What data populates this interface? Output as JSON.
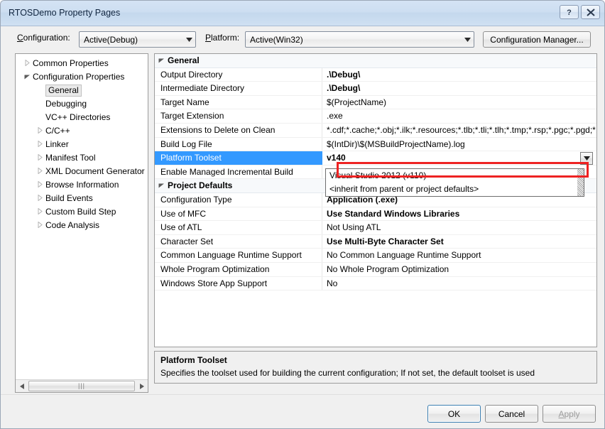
{
  "window": {
    "title": "RTOSDemo Property Pages",
    "help_button": "?",
    "close_button": "x"
  },
  "toolbar": {
    "configuration_label": "Configuration:",
    "configuration_value": "Active(Debug)",
    "platform_label": "Platform:",
    "platform_value": "Active(Win32)",
    "configuration_manager_label": "Configuration Manager..."
  },
  "tree": {
    "items": [
      {
        "label": "Common Properties",
        "indent": 0,
        "twisty": "collapsed",
        "selected": false
      },
      {
        "label": "Configuration Properties",
        "indent": 0,
        "twisty": "expanded",
        "selected": false
      },
      {
        "label": "General",
        "indent": 1,
        "twisty": "none",
        "selected": true
      },
      {
        "label": "Debugging",
        "indent": 1,
        "twisty": "none",
        "selected": false
      },
      {
        "label": "VC++ Directories",
        "indent": 1,
        "twisty": "none",
        "selected": false
      },
      {
        "label": "C/C++",
        "indent": 1,
        "twisty": "collapsed",
        "selected": false
      },
      {
        "label": "Linker",
        "indent": 1,
        "twisty": "collapsed",
        "selected": false
      },
      {
        "label": "Manifest Tool",
        "indent": 1,
        "twisty": "collapsed",
        "selected": false
      },
      {
        "label": "XML Document Generator",
        "indent": 1,
        "twisty": "collapsed",
        "selected": false
      },
      {
        "label": "Browse Information",
        "indent": 1,
        "twisty": "collapsed",
        "selected": false
      },
      {
        "label": "Build Events",
        "indent": 1,
        "twisty": "collapsed",
        "selected": false
      },
      {
        "label": "Custom Build Step",
        "indent": 1,
        "twisty": "collapsed",
        "selected": false
      },
      {
        "label": "Code Analysis",
        "indent": 1,
        "twisty": "collapsed",
        "selected": false
      }
    ]
  },
  "grid": {
    "rows": [
      {
        "kind": "group",
        "name": "General",
        "value": ""
      },
      {
        "kind": "prop",
        "name": "Output Directory",
        "value": ".\\Debug\\",
        "bold": true
      },
      {
        "kind": "prop",
        "name": "Intermediate Directory",
        "value": ".\\Debug\\",
        "bold": true
      },
      {
        "kind": "prop",
        "name": "Target Name",
        "value": "$(ProjectName)",
        "bold": false
      },
      {
        "kind": "prop",
        "name": "Target Extension",
        "value": ".exe",
        "bold": false
      },
      {
        "kind": "prop",
        "name": "Extensions to Delete on Clean",
        "value": "*.cdf;*.cache;*.obj;*.ilk;*.resources;*.tlb;*.tli;*.tlh;*.tmp;*.rsp;*.pgc;*.pgd;*.meta",
        "bold": false
      },
      {
        "kind": "prop",
        "name": "Build Log File",
        "value": "$(IntDir)\\$(MSBuildProjectName).log",
        "bold": false
      },
      {
        "kind": "sel",
        "name": "Platform Toolset",
        "value": "v140",
        "bold": true
      },
      {
        "kind": "prop",
        "name": "Enable Managed Incremental Build",
        "value": "",
        "bold": false
      },
      {
        "kind": "group",
        "name": "Project Defaults",
        "value": ""
      },
      {
        "kind": "prop",
        "name": "Configuration Type",
        "value": "Application (.exe)",
        "bold": true
      },
      {
        "kind": "prop",
        "name": "Use of MFC",
        "value": "Use Standard Windows Libraries",
        "bold": true
      },
      {
        "kind": "prop",
        "name": "Use of ATL",
        "value": "Not Using ATL",
        "bold": false
      },
      {
        "kind": "prop",
        "name": "Character Set",
        "value": "Use Multi-Byte Character Set",
        "bold": true
      },
      {
        "kind": "prop",
        "name": "Common Language Runtime Support",
        "value": "No Common Language Runtime Support",
        "bold": false
      },
      {
        "kind": "prop",
        "name": "Whole Program Optimization",
        "value": "No Whole Program Optimization",
        "bold": false
      },
      {
        "kind": "prop",
        "name": "Windows Store App Support",
        "value": "No",
        "bold": false
      }
    ]
  },
  "dropdown": {
    "open": true,
    "options": [
      {
        "label": "Visual Studio 2012 (v110)",
        "highlighted": true
      },
      {
        "label": "<inherit from parent or project defaults>",
        "highlighted": false
      }
    ],
    "highlight_color": "#ee2222"
  },
  "description": {
    "title": "Platform Toolset",
    "text": "Specifies the toolset used for building the current configuration; If not set, the default toolset is used"
  },
  "footer": {
    "ok_label": "OK",
    "cancel_label": "Cancel",
    "apply_label": "Apply"
  }
}
